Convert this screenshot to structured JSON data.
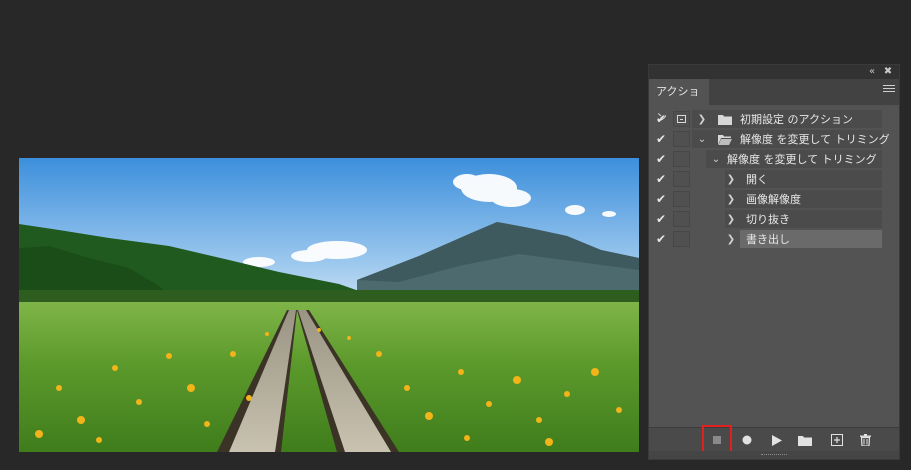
{
  "panel": {
    "tab_label": "アクション",
    "controls": {
      "collapse_icon": "double-chevron-left-icon",
      "close_icon": "close-icon",
      "menu_icon": "hamburger-menu-icon"
    },
    "rows": [
      {
        "checked": true,
        "dialog": true,
        "expanded": false,
        "type": "set",
        "label": "初期設定 のアクション"
      },
      {
        "checked": true,
        "dialog": false,
        "expanded": true,
        "type": "set",
        "label": "解像度 を変更して トリミング"
      },
      {
        "checked": true,
        "dialog": false,
        "expanded": true,
        "type": "action",
        "label": "解像度 を変更して トリミング"
      },
      {
        "checked": true,
        "dialog": false,
        "expanded": false,
        "type": "step",
        "label": "開く"
      },
      {
        "checked": true,
        "dialog": false,
        "expanded": false,
        "type": "step",
        "label": "画像解像度"
      },
      {
        "checked": true,
        "dialog": false,
        "expanded": false,
        "type": "step",
        "label": "切り抜き"
      },
      {
        "checked": true,
        "dialog": false,
        "expanded": false,
        "type": "step",
        "label": "書き出し",
        "selected": true
      }
    ],
    "bottom_buttons": [
      {
        "name": "stop-playing-recording",
        "icon": "stop-icon",
        "highlighted": true,
        "highlight_color": "#e22020"
      },
      {
        "name": "begin-recording",
        "icon": "record-icon"
      },
      {
        "name": "play-selection",
        "icon": "play-icon"
      },
      {
        "name": "create-new-set",
        "icon": "folder-icon"
      },
      {
        "name": "create-new-action",
        "icon": "new-item-icon"
      },
      {
        "name": "delete",
        "icon": "trash-icon"
      }
    ]
  },
  "colors": {
    "background": "#282828",
    "panel": "#535353",
    "highlight": "#e22020"
  }
}
